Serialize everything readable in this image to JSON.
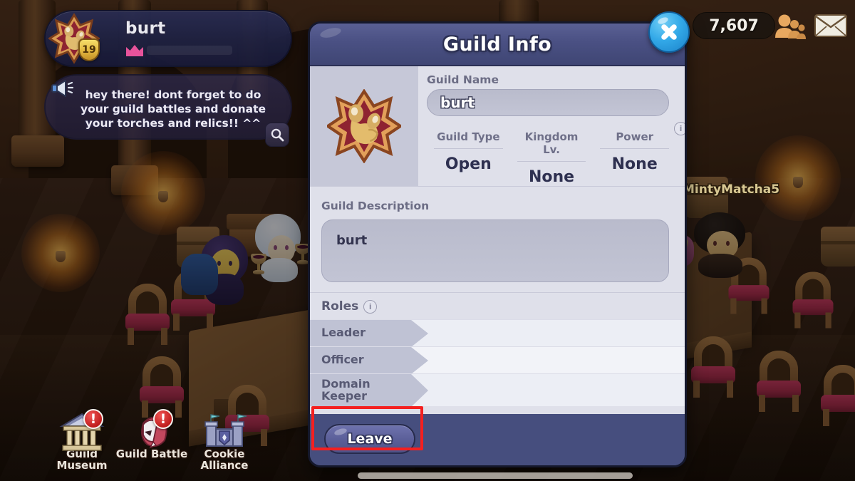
{
  "hud": {
    "player": {
      "name": "burt",
      "level": "19",
      "emblem_icon": "guild-star-emblem",
      "crown_icon": "crown-icon"
    },
    "announcement": {
      "megaphone_icon": "megaphone-icon",
      "text": "hey there! dont forget to do your guild battles and donate your torches and relics!! ^^",
      "search_icon": "magnifier-icon"
    },
    "currency": {
      "value": "7,607"
    },
    "friends_icon": "friends-icon",
    "mail_icon": "mail-envelope-icon",
    "world_player_name": "MintyMatcha5"
  },
  "bottom_nav": [
    {
      "label": "Guild\nMuseum",
      "label_line1": "Guild",
      "label_line2": "Museum",
      "icon": "museum-icon",
      "alert": "!"
    },
    {
      "label": "Guild Battle",
      "label_line1": "Guild Battle",
      "label_line2": "",
      "icon": "battle-helmet-icon",
      "alert": "!"
    },
    {
      "label": "Cookie\nAlliance",
      "label_line1": "Cookie",
      "label_line2": "Alliance",
      "icon": "castle-icon",
      "alert": ""
    }
  ],
  "modal": {
    "title": "Guild Info",
    "close_icon": "close-x-icon",
    "emblem_icon": "guild-star-emblem",
    "guild_name_label": "Guild Name",
    "guild_name_value": "burt",
    "stats": [
      {
        "label": "Guild Type",
        "value": "Open"
      },
      {
        "label": "Kingdom Lv.",
        "value": "None"
      },
      {
        "label": "Power",
        "value": "None"
      }
    ],
    "stats_info_icon": "i",
    "description_label": "Guild Description",
    "description_value": "burt",
    "roles_label": "Roles",
    "roles_info_icon": "i",
    "roles": [
      {
        "name": "Leader",
        "name_line2": "",
        "members": ""
      },
      {
        "name": "Officer",
        "name_line2": "",
        "members": ""
      },
      {
        "name": "Domain",
        "name_line2": "Keeper",
        "members": ""
      }
    ],
    "leave_label": "Leave"
  },
  "colors": {
    "modal_frame": "#424a7a",
    "modal_header": "#4a5083",
    "modal_body": "#dfe0ea",
    "close_blue": "#33a9e8",
    "highlight_red": "#f42020",
    "leave_purple": "#5c609a"
  }
}
